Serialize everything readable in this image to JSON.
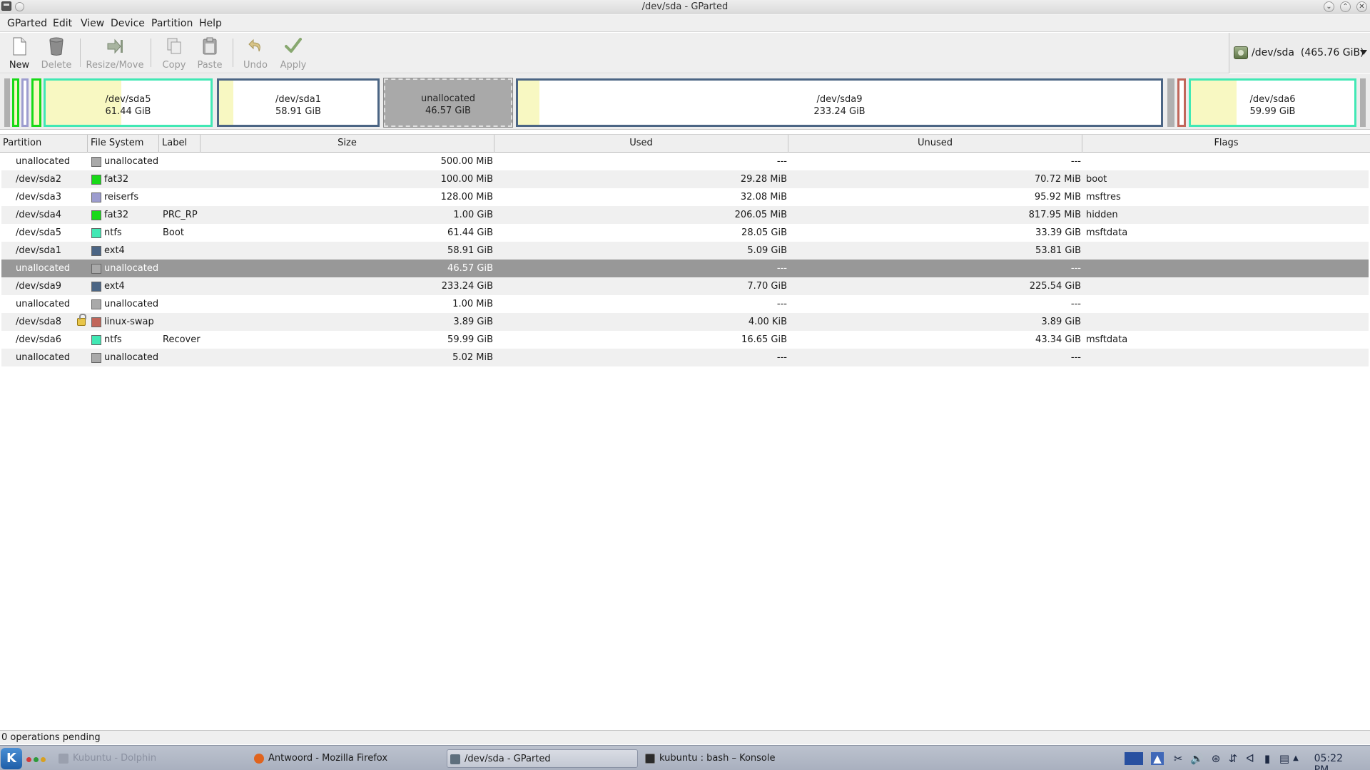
{
  "window": {
    "title": "/dev/sda - GParted"
  },
  "menu": {
    "items": [
      "GParted",
      "Edit",
      "View",
      "Device",
      "Partition",
      "Help"
    ]
  },
  "toolbar": {
    "buttons": [
      {
        "label": "New",
        "icon": "new-document-icon",
        "enabled": true
      },
      {
        "label": "Delete",
        "icon": "trash-icon",
        "enabled": false
      },
      {
        "label": "Resize/Move",
        "icon": "resize-arrow-icon",
        "enabled": false
      },
      {
        "label": "Copy",
        "icon": "copy-icon",
        "enabled": false
      },
      {
        "label": "Paste",
        "icon": "paste-icon",
        "enabled": false
      },
      {
        "label": "Undo",
        "icon": "undo-icon",
        "enabled": false
      },
      {
        "label": "Apply",
        "icon": "checkmark-icon",
        "enabled": false
      }
    ],
    "device": {
      "name": "/dev/sda",
      "size": "(465.76 GiB)",
      "label": "/dev/sda  (465.76 GiB)"
    }
  },
  "partition_map": {
    "segments": [
      {
        "name": "/dev/sda5",
        "size": "61.44 GiB",
        "used_fraction": 0.46,
        "color": "#41e8b4"
      },
      {
        "name": "/dev/sda1",
        "size": "58.91 GiB",
        "used_fraction": 0.09,
        "color": "#4b6584"
      },
      {
        "name": "unallocated",
        "size": "46.57 GiB",
        "used_fraction": 0,
        "color": "#a9a9a9"
      },
      {
        "name": "/dev/sda9",
        "size": "233.24 GiB",
        "used_fraction": 0.033,
        "color": "#4b6584"
      },
      {
        "name": "/dev/sda6",
        "size": "59.99 GiB",
        "used_fraction": 0.28,
        "color": "#41e8b4"
      }
    ]
  },
  "table": {
    "headers": {
      "partition": "Partition",
      "filesystem": "File System",
      "label": "Label",
      "size": "Size",
      "used": "Used",
      "unused": "Unused",
      "flags": "Flags"
    },
    "rows": [
      {
        "partition": "unallocated",
        "filesystem": "unallocated",
        "fs_color": "#a9a9a9",
        "label": "",
        "size": "500.00 MiB",
        "used": "---",
        "unused": "---",
        "flags": "",
        "locked": false
      },
      {
        "partition": "/dev/sda2",
        "filesystem": "fat32",
        "fs_color": "#18d918",
        "label": "",
        "size": "100.00 MiB",
        "used": "29.28 MiB",
        "unused": "70.72 MiB",
        "flags": "boot",
        "locked": false
      },
      {
        "partition": "/dev/sda3",
        "filesystem": "reiserfs",
        "fs_color": "#9d9dcf",
        "label": "",
        "size": "128.00 MiB",
        "used": "32.08 MiB",
        "unused": "95.92 MiB",
        "flags": "msftres",
        "locked": false
      },
      {
        "partition": "/dev/sda4",
        "filesystem": "fat32",
        "fs_color": "#18d918",
        "label": "PRC_RP",
        "size": "1.00 GiB",
        "used": "206.05 MiB",
        "unused": "817.95 MiB",
        "flags": "hidden",
        "locked": false
      },
      {
        "partition": "/dev/sda5",
        "filesystem": "ntfs",
        "fs_color": "#41e8b4",
        "label": "Boot",
        "size": "61.44 GiB",
        "used": "28.05 GiB",
        "unused": "33.39 GiB",
        "flags": "msftdata",
        "locked": false
      },
      {
        "partition": "/dev/sda1",
        "filesystem": "ext4",
        "fs_color": "#4b6584",
        "label": "",
        "size": "58.91 GiB",
        "used": "5.09 GiB",
        "unused": "53.81 GiB",
        "flags": "",
        "locked": false
      },
      {
        "partition": "unallocated",
        "filesystem": "unallocated",
        "fs_color": "#a9a9a9",
        "label": "",
        "size": "46.57 GiB",
        "used": "---",
        "unused": "---",
        "flags": "",
        "locked": false,
        "selected": true
      },
      {
        "partition": "/dev/sda9",
        "filesystem": "ext4",
        "fs_color": "#4b6584",
        "label": "",
        "size": "233.24 GiB",
        "used": "7.70 GiB",
        "unused": "225.54 GiB",
        "flags": "",
        "locked": false
      },
      {
        "partition": "unallocated",
        "filesystem": "unallocated",
        "fs_color": "#a9a9a9",
        "label": "",
        "size": "1.00 MiB",
        "used": "---",
        "unused": "---",
        "flags": "",
        "locked": false
      },
      {
        "partition": "/dev/sda8",
        "filesystem": "linux-swap",
        "fs_color": "#c1665a",
        "label": "",
        "size": "3.89 GiB",
        "used": "4.00 KiB",
        "unused": "3.89 GiB",
        "flags": "",
        "locked": true
      },
      {
        "partition": "/dev/sda6",
        "filesystem": "ntfs",
        "fs_color": "#41e8b4",
        "label": "Recover",
        "size": "59.99 GiB",
        "used": "16.65 GiB",
        "unused": "43.34 GiB",
        "flags": "msftdata",
        "locked": false
      },
      {
        "partition": "unallocated",
        "filesystem": "unallocated",
        "fs_color": "#a9a9a9",
        "label": "",
        "size": "5.02 MiB",
        "used": "---",
        "unused": "---",
        "flags": "",
        "locked": false
      }
    ]
  },
  "status": {
    "text": "0 operations pending"
  },
  "taskbar": {
    "tasks": [
      {
        "label": "Kubuntu - Dolphin",
        "icon": "folder-icon",
        "active": false,
        "dim": true
      },
      {
        "label": "Antwoord - Mozilla Firefox",
        "icon": "firefox-icon",
        "active": false,
        "dim": false
      },
      {
        "label": "/dev/sda - GParted",
        "icon": "gparted-icon",
        "active": true,
        "dim": false
      },
      {
        "label": "kubuntu : bash – Konsole",
        "icon": "terminal-icon",
        "active": false,
        "dim": false
      }
    ],
    "clock": "05:22 PM"
  }
}
